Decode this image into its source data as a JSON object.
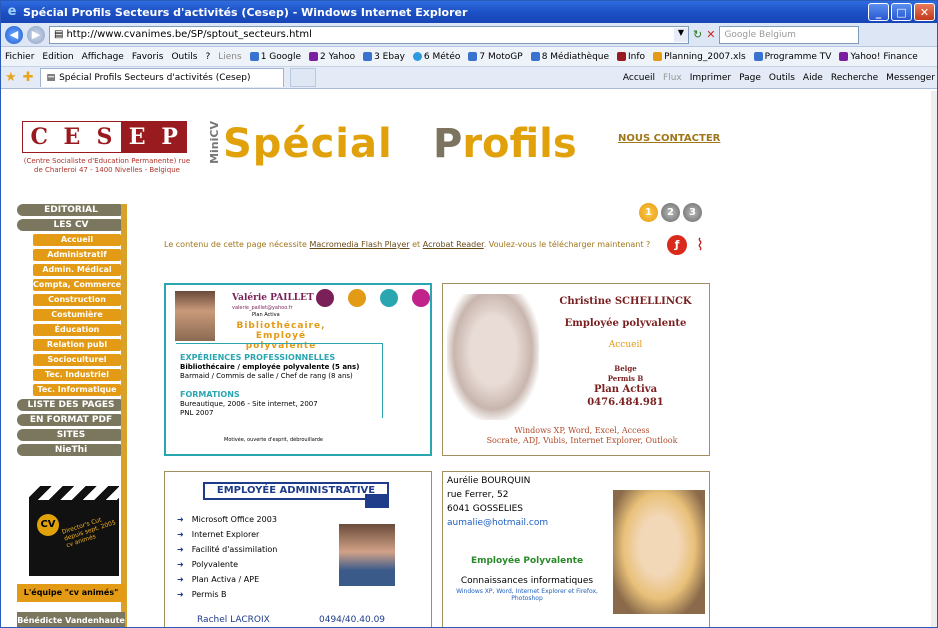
{
  "window": {
    "title": "Spécial Profils Secteurs d'activités (Cesep) - Windows Internet Explorer",
    "url": "http://www.cvanimes.be/SP/sptout_secteurs.html",
    "search_placeholder": "Google Belgium"
  },
  "menu": [
    "Fichier",
    "Edition",
    "Affichage",
    "Favoris",
    "Outils",
    "?"
  ],
  "links_label": "Liens",
  "links": [
    "1 Google",
    "2 Yahoo",
    "3 Ebay",
    "6 Météo",
    "7 MotoGP",
    "8 Médiathèque",
    "Info",
    "Planning_2007.xls",
    "Programme TV",
    "Yahoo! Finance"
  ],
  "tab": {
    "title": "Spécial Profils Secteurs d'activités (Cesep)"
  },
  "toolbar": [
    "Accueil",
    "Flux",
    "Imprimer",
    "Page",
    "Outils",
    "Aide",
    "Recherche",
    "Messenger"
  ],
  "page": {
    "logo": [
      "C",
      "E",
      "S",
      "E",
      "P"
    ],
    "logo_sub": "(Centre Socialiste d'Education Permanente) rue de Charleroi 47 - 1400 Nivelles - Belgique",
    "minicv": "MiniCV",
    "title_a": "Spécial",
    "title_b_first": "P",
    "title_b_rest": "rofils",
    "contact": "NOUS CONTACTER",
    "nav": {
      "top": [
        "EDITORIAL",
        "LES CV"
      ],
      "sub": [
        "Accueil",
        "Administratif",
        "Admin. Médical",
        "Compta, Commerce",
        "Construction",
        "Costumière",
        "Éducation",
        "Relation publ",
        "Socioculturel",
        "Tec. Industriel",
        "Tec. Informatique"
      ],
      "bottom": [
        "LISTE DES PAGES",
        "EN FORMAT PDF",
        "SITES",
        "NieThi"
      ]
    },
    "pages": [
      "1",
      "2",
      "3"
    ],
    "notice": "Le contenu de cette page nécessite",
    "notice_l1": "Macromedia Flash Player",
    "notice_and": "et",
    "notice_l2": "Acrobat Reader",
    "notice_q": ". Voulez-vous le télécharger maintenant ?",
    "equipe": "L'équipe \"cv animés\"",
    "benedicte": "Bénédicte Vandenhaute",
    "clap_text": "Director's Cut depuis sept. 2005 cv animés"
  },
  "cv1": {
    "name": "Valérie PAILLET",
    "email": "valerie_paillet@yahoo.fr",
    "plan": "Plan Activa",
    "job": "Bibliothécaire, Employé polyvalente",
    "exp_h": "EXPÉRIENCES PROFESSIONNELLES",
    "exp1": "Bibliothécaire / employée polyvalente (5 ans)",
    "exp2": "Barmaid / Commis de salle / Chef de rang (8 ans)",
    "form_h": "FORMATIONS",
    "form1": "Bureautique, 2006 - Site internet, 2007",
    "form2": "PNL 2007",
    "mot": "Motivée, ouverte d'esprit, débrouillarde",
    "dot_colors": [
      "#7a1f57",
      "#e39a15",
      "#2aa6b0",
      "#c2238a"
    ]
  },
  "cv2": {
    "name": "Christine SCHELLINCK",
    "job": "Employée polyvalente",
    "accueil": "Accueil",
    "l1": "Belge",
    "l2": "Permis B",
    "l3": "Plan Activa",
    "tel": "0476.484.981",
    "skills1": "Windows XP, Word, Excel, Access",
    "skills2": "Socrate, ADJ, Vubis, Internet Explorer, Outlook"
  },
  "cv3": {
    "header": "EMPLOYÉE ADMINISTRATIVE",
    "items": [
      "Microsoft Office 2003",
      "Internet Explorer",
      "Facilité d'assimilation",
      "Polyvalente",
      "Plan Activa / APE",
      "Permis B"
    ],
    "name": "Rachel LACROIX",
    "tel": "0494/40.40.09"
  },
  "cv4": {
    "name": "Aurélie BOURQUIN",
    "street": "rue Ferrer, 52",
    "city": "6041 GOSSELIES",
    "email": "aumalie@hotmail.com",
    "job": "Employée Polyvalente",
    "kh": "Connaissances informatiques",
    "k": "Windows XP, Word, Internet Explorer et Firefox, Photoshop"
  }
}
